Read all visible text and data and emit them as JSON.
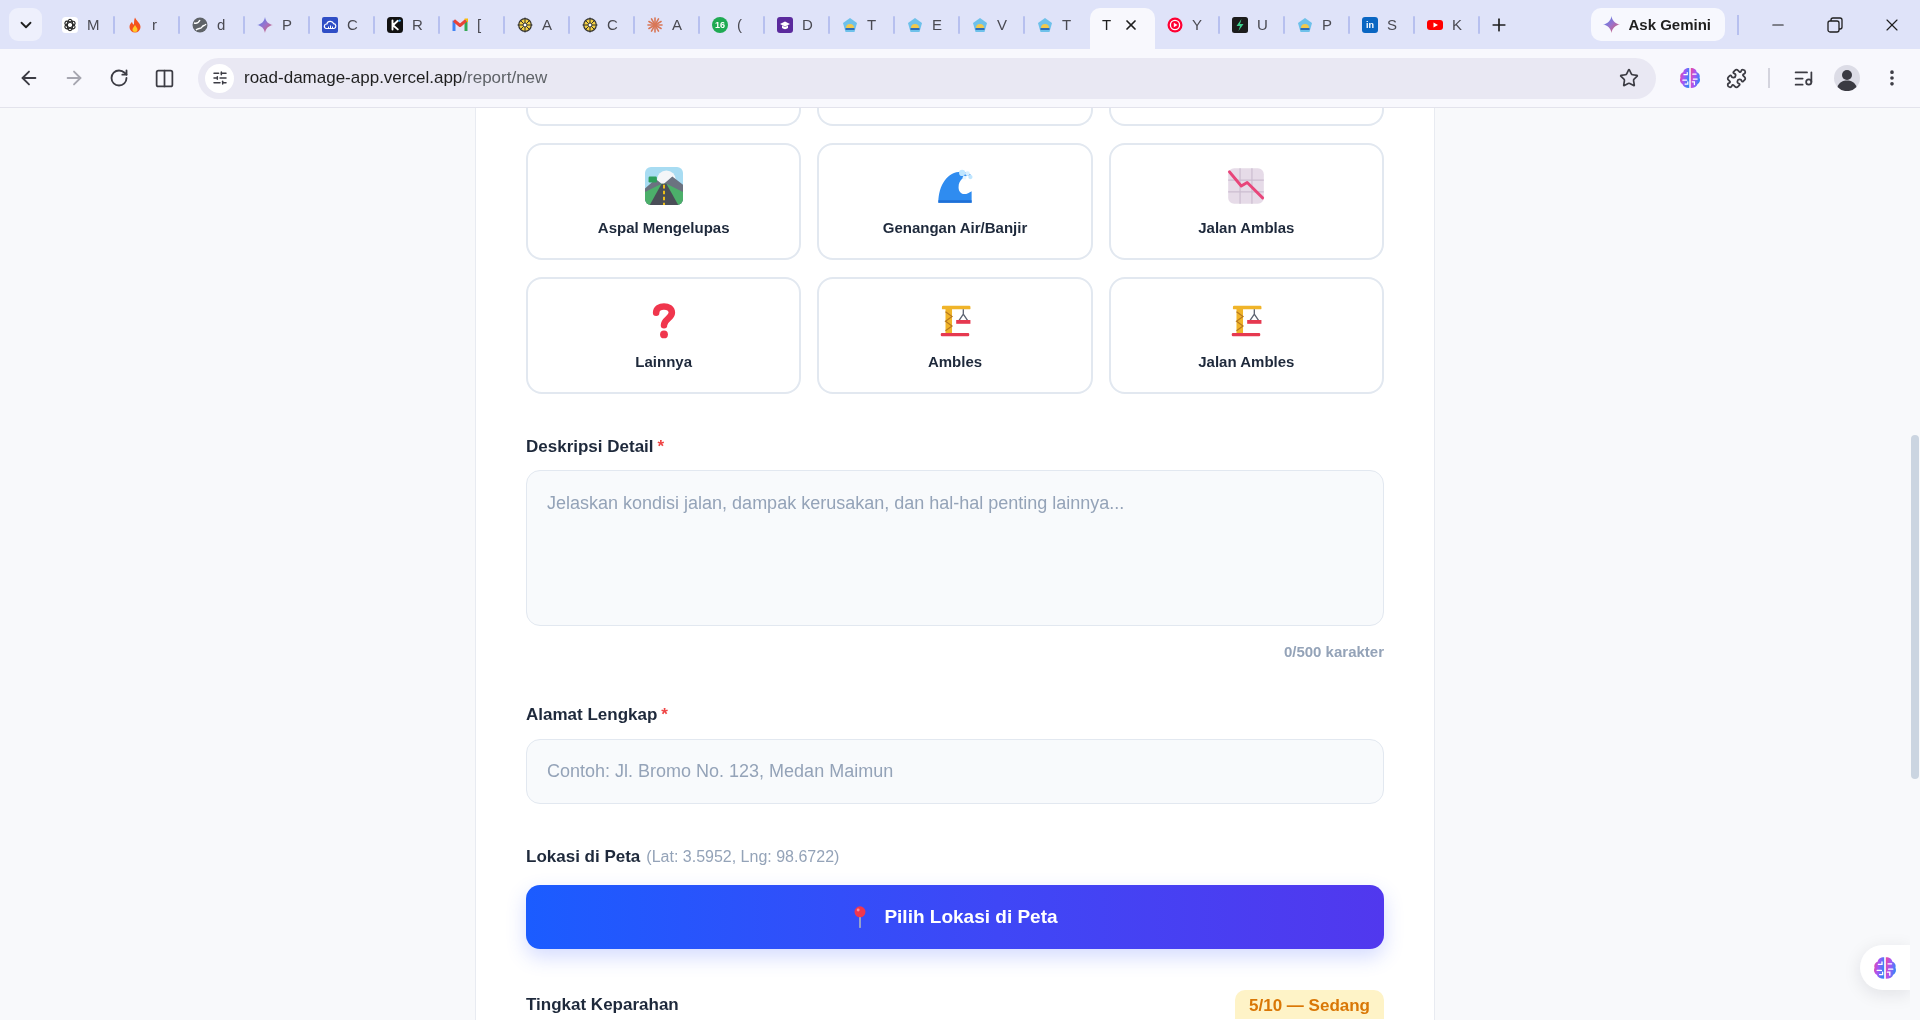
{
  "browser": {
    "tabs": [
      {
        "title": "M",
        "kind": "knot",
        "selected": false
      },
      {
        "title": "r",
        "kind": "flame",
        "selected": false
      },
      {
        "title": "d",
        "kind": "globe",
        "selected": false
      },
      {
        "title": "P",
        "kind": "sparkle",
        "selected": false
      },
      {
        "title": "C",
        "kind": "cloud",
        "selected": false
      },
      {
        "title": "R",
        "kind": "darktile",
        "selected": false
      },
      {
        "title": "[",
        "kind": "mail",
        "selected": false
      },
      {
        "title": "A",
        "kind": "wheel",
        "selected": false
      },
      {
        "title": "C",
        "kind": "wheel",
        "selected": false
      },
      {
        "title": "A",
        "kind": "burst",
        "selected": false
      },
      {
        "title": "(",
        "kind": "greendisc",
        "badge": "16",
        "selected": false
      },
      {
        "title": "D",
        "kind": "cap",
        "selected": false
      },
      {
        "title": "T",
        "kind": "emblem",
        "selected": false
      },
      {
        "title": "E",
        "kind": "emblem",
        "selected": false
      },
      {
        "title": "V",
        "kind": "emblem",
        "selected": false
      },
      {
        "title": "T",
        "kind": "emblem",
        "selected": false
      },
      {
        "title": "T",
        "kind": "blank",
        "selected": true
      },
      {
        "title": "Y",
        "kind": "ring",
        "selected": false
      },
      {
        "title": "U",
        "kind": "bolt",
        "selected": false
      },
      {
        "title": "P",
        "kind": "emblem",
        "selected": false
      },
      {
        "title": "S",
        "kind": "bluetile",
        "badge": "in",
        "selected": false
      },
      {
        "title": "K",
        "kind": "video",
        "selected": false
      }
    ],
    "ask_button": "Ask Gemini",
    "address": {
      "host": "road-damage-app.vercel.app",
      "path": "/report/new"
    }
  },
  "categories": [
    {
      "kind": "stub",
      "selected": false
    },
    {
      "kind": "stub",
      "selected": false
    },
    {
      "kind": "stub",
      "selected": false
    },
    {
      "label": "Aspal Mengelupas",
      "kind": "road",
      "selected": false
    },
    {
      "label": "Genangan Air/Banjir",
      "kind": "wave",
      "selected": false
    },
    {
      "label": "Jalan Amblas",
      "kind": "chart",
      "selected": false
    },
    {
      "label": "Lainnya",
      "kind": "question",
      "selected": false
    },
    {
      "label": "Ambles",
      "kind": "crane",
      "selected": false
    },
    {
      "label": "Jalan Ambles",
      "kind": "crane",
      "selected": false
    }
  ],
  "description": {
    "label": "Deskripsi Detail",
    "required_mark": "*",
    "placeholder": "Jelaskan kondisi jalan, dampak kerusakan, dan hal-hal penting lainnya...",
    "counter": "0/500 karakter"
  },
  "address_field": {
    "label": "Alamat Lengkap",
    "required_mark": "*",
    "placeholder": "Contoh: Jl. Bromo No. 123, Medan Maimun"
  },
  "location": {
    "label": "Lokasi di Peta",
    "coordinates": "(Lat: 3.5952, Lng: 98.6722)",
    "button": "Pilih Lokasi di Peta"
  },
  "severity": {
    "label": "Tingkat Keparahan",
    "badge": "5/10 — Sedang"
  }
}
